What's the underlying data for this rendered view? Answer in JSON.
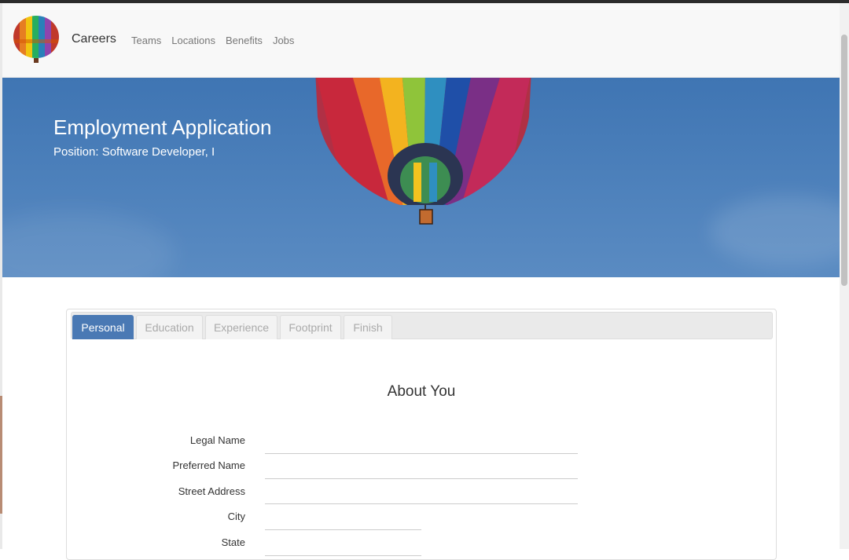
{
  "navbar": {
    "brand": "Careers",
    "links": [
      {
        "label": "Teams"
      },
      {
        "label": "Locations"
      },
      {
        "label": "Benefits"
      },
      {
        "label": "Jobs"
      }
    ]
  },
  "hero": {
    "title": "Employment Application",
    "subtitle": "Position: Software Developer, I"
  },
  "tabs": [
    {
      "label": "Personal",
      "active": true
    },
    {
      "label": "Education",
      "active": false
    },
    {
      "label": "Experience",
      "active": false
    },
    {
      "label": "Footprint",
      "active": false
    },
    {
      "label": "Finish",
      "active": false
    }
  ],
  "section": {
    "title": "About You",
    "fields": [
      {
        "label": "Legal Name",
        "value": ""
      },
      {
        "label": "Preferred Name",
        "value": ""
      },
      {
        "label": "Street Address",
        "value": ""
      },
      {
        "label": "City",
        "value": ""
      },
      {
        "label": "State",
        "value": ""
      }
    ]
  },
  "colors": {
    "accent": "#4a79b4",
    "hero_sky": "#4b7fba",
    "navbar_bg": "#f8f8f8"
  }
}
